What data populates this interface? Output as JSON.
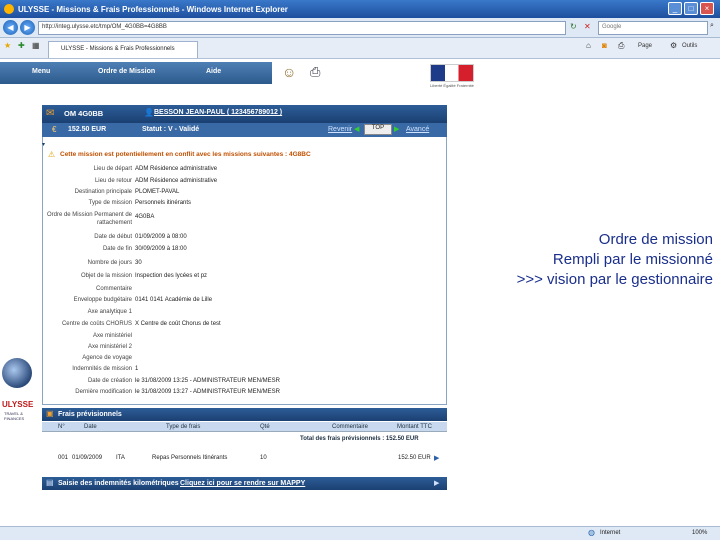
{
  "window": {
    "title": "ULYSSE - Missions & Frais Professionnels - Windows Internet Explorer"
  },
  "browser": {
    "url": "http://integ.ulysse.etc/tmp/OM_4G0BB=4G8BB",
    "search_placeholder": "Google",
    "tab_label": "ULYSSE - Missions & Frais Professionnels",
    "page_label": "Page",
    "tools_label": "Outils",
    "status_zone": "Internet",
    "zoom": "100%"
  },
  "app_nav": {
    "items": [
      "Menu",
      "Ordre de Mission",
      "Aide"
    ]
  },
  "flag": {
    "caption": "Liberté Égalité Fraternité"
  },
  "mission": {
    "id": "OM 4G0BB",
    "person": "BESSON JEAN-PAUL ( 123456789012 )",
    "amount": "152.50 EUR",
    "status": "Statut : V - Validé",
    "back_link": "Revenir",
    "top_label": "TOP",
    "next_link": "Avancé",
    "conflict": "Cette mission est potentiellement en conflit avec les missions suivantes : 4G8BC"
  },
  "fields": [
    {
      "label": "Lieu de départ",
      "value": "ADM Résidence administrative"
    },
    {
      "label": "Lieu de retour",
      "value": "ADM Résidence administrative"
    },
    {
      "label": "Destination principale",
      "value": "PLOMET-PAVAL"
    },
    {
      "label": "Type de mission",
      "value": "Personnels itinérants"
    },
    {
      "label": "Ordre de Mission Permanent de rattachement",
      "value": "4G0BA"
    },
    {
      "label": "Date de début",
      "value": "01/09/2009 à 08:00"
    },
    {
      "label": "Date de fin",
      "value": "30/09/2009 à 18:00"
    },
    {
      "label": "Nombre de jours",
      "value": "30"
    },
    {
      "label": "Objet de la mission",
      "value": "Inspection des lycées et pz"
    },
    {
      "label": "Commentaire",
      "value": ""
    },
    {
      "label": "Enveloppe budgétaire",
      "value": "0141 0141 Académie de Lille"
    },
    {
      "label": "Axe analytique 1",
      "value": ""
    },
    {
      "label": "Centre de coûts CHORUS",
      "value": "X Centre de coût Chorus de test"
    },
    {
      "label": "Axe ministériel",
      "value": ""
    },
    {
      "label": "Axe ministériel 2",
      "value": ""
    },
    {
      "label": "Agence de voyage",
      "value": ""
    },
    {
      "label": "Indemnités de mission",
      "value": "1"
    },
    {
      "label": "Date de création",
      "value": "le 31/08/2009 13:25 - ADMINISTRATEUR MEN/MESR"
    },
    {
      "label": "Dernière modification",
      "value": "le 31/08/2009 13:27 - ADMINISTRATEUR MEN/MESR"
    }
  ],
  "frais": {
    "title": "Frais prévisionnels",
    "columns": [
      "N°",
      "Date",
      "Type de frais",
      "Qté",
      "Commentaire",
      "Montant TTC"
    ],
    "total": "Total des frais prévisionnels : 152.50 EUR",
    "rows": [
      [
        "001",
        "01/09/2009",
        "ITA",
        "Repas Personnels Itinérants",
        "10",
        "152.50 EUR"
      ]
    ]
  },
  "indemnites": {
    "title": "Saisie des indemnités kilométriques",
    "link": "Cliquez ici pour se rendre sur MAPPY"
  },
  "logo": {
    "text": "ULYSSE",
    "sub": "TRAVEL & FINANCES"
  },
  "overlay": {
    "line1": "Ordre de mission",
    "line2": "Rempli par le missionné",
    "line3": ">>> vision par le gestionnaire"
  }
}
